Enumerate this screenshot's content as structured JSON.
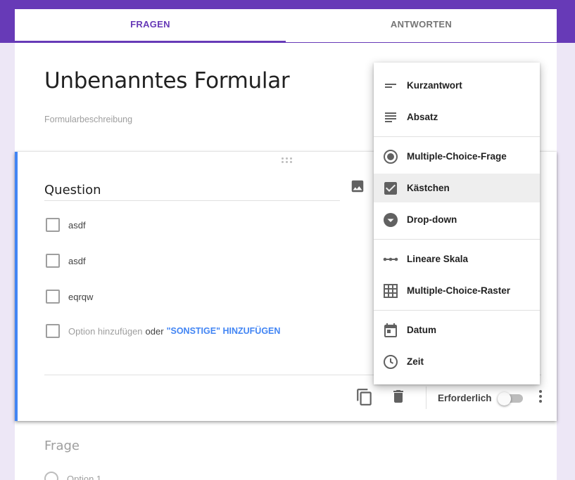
{
  "tabs": [
    {
      "label": "FRAGEN",
      "active": true
    },
    {
      "label": "ANTWORTEN",
      "active": false
    }
  ],
  "form": {
    "title": "Unbenanntes Formular",
    "description_placeholder": "Formularbeschreibung"
  },
  "question": {
    "title": "Question",
    "options": [
      "asdf",
      "asdf",
      "eqrqw"
    ],
    "add_option": "Option hinzufügen",
    "or_text": "oder",
    "add_other": "\"SONSTIGE\" HINZUFÜGEN",
    "required_label": "Erforderlich",
    "required": false
  },
  "next_question": {
    "title": "Frage",
    "option": "Option 1"
  },
  "type_menu": {
    "groups": [
      [
        {
          "label": "Kurzantwort",
          "icon": "short-answer-icon"
        },
        {
          "label": "Absatz",
          "icon": "paragraph-icon"
        }
      ],
      [
        {
          "label": "Multiple-Choice-Frage",
          "icon": "radio-button-icon"
        },
        {
          "label": "Kästchen",
          "icon": "checkbox-icon",
          "selected": true
        },
        {
          "label": "Drop-down",
          "icon": "dropdown-icon"
        }
      ],
      [
        {
          "label": "Lineare Skala",
          "icon": "linear-scale-icon"
        },
        {
          "label": "Multiple-Choice-Raster",
          "icon": "grid-icon"
        }
      ],
      [
        {
          "label": "Datum",
          "icon": "calendar-icon"
        },
        {
          "label": "Zeit",
          "icon": "clock-icon"
        }
      ]
    ]
  },
  "colors": {
    "brand": "#673ab7",
    "accent": "#4285f4",
    "background": "#ede7f6"
  }
}
